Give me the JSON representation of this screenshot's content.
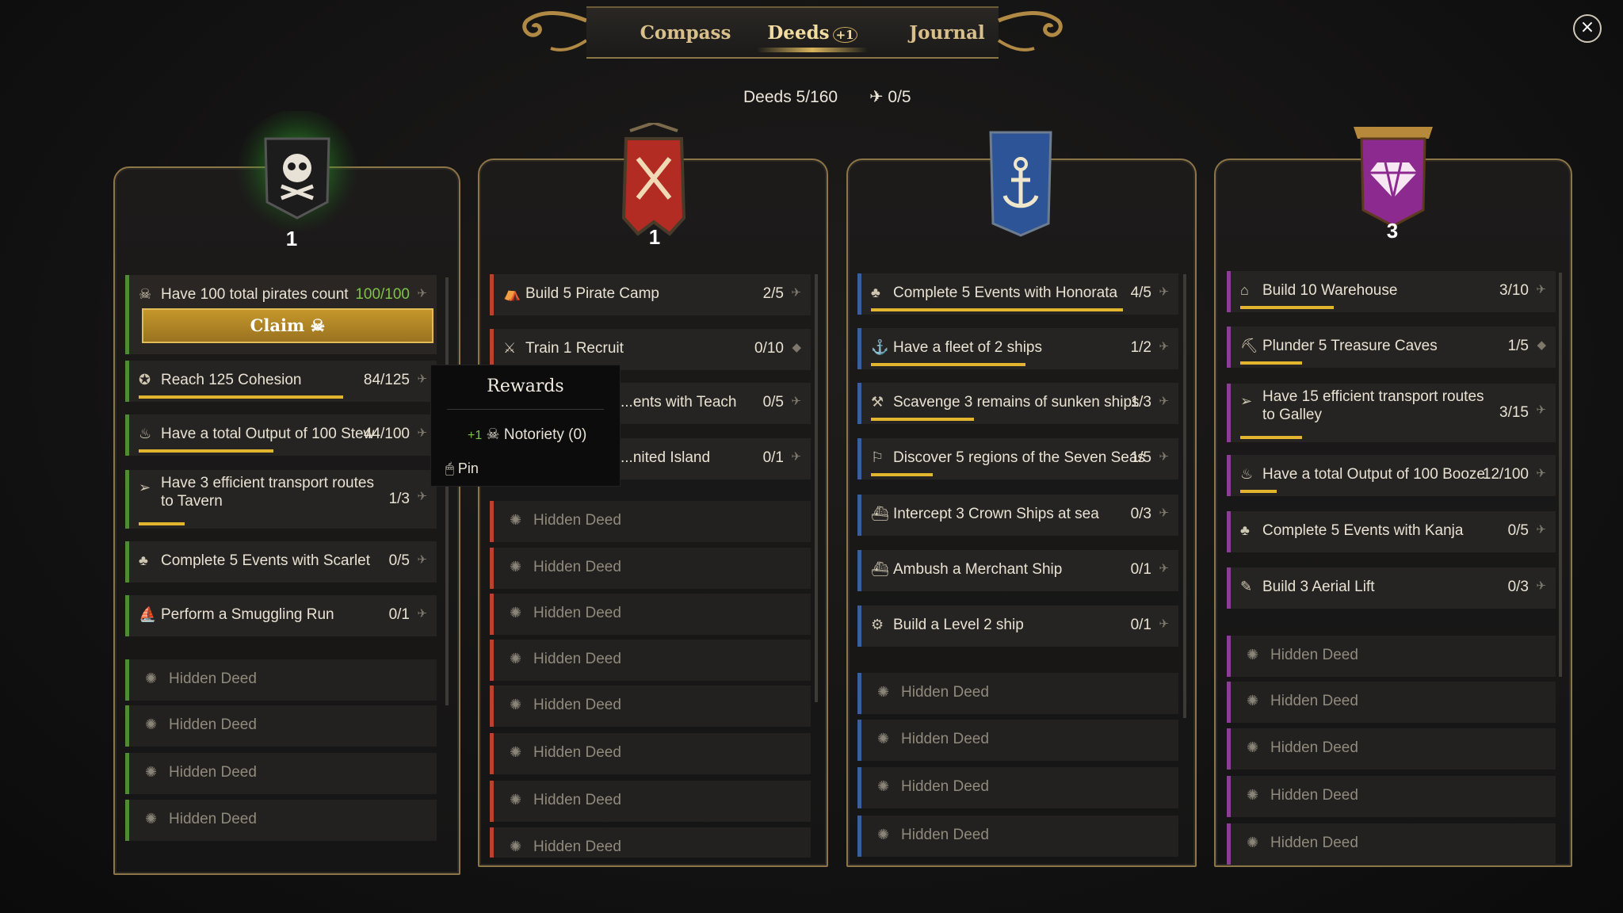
{
  "tabs": {
    "compass": "Compass",
    "deeds": "Deeds",
    "deeds_badge": "+1",
    "journal": "Journal"
  },
  "close_icon": "×",
  "summary": {
    "deeds_label": "Deeds",
    "deeds_count": "5/160",
    "pin_icon": "✈",
    "pinned": "0/5"
  },
  "colors": {
    "gold": "#e3b52f",
    "green": "#4e8b35",
    "red": "#b7432f",
    "blue": "#3b5f9c",
    "purple": "#8a3f94"
  },
  "columns": [
    {
      "banner": "skull-flag",
      "level": "1",
      "deeds": [
        {
          "name": "Have 100 total pirates count",
          "progress": "100/100",
          "claim": "Claim",
          "fill": 1.0
        },
        {
          "name": "Reach 125 Cohesion",
          "progress": "84/125",
          "fill": 0.67
        },
        {
          "name": "Have a total Output of 100 Stew",
          "progress": "44/100",
          "fill": 0.44
        },
        {
          "name": "Have 3 efficient transport routes to Tavern",
          "progress": "1/3",
          "fill": 0.33
        },
        {
          "name": "Complete 5 Events with Scarlet",
          "progress": "0/5",
          "fill": 0
        },
        {
          "name": "Perform a Smuggling Run",
          "progress": "0/1",
          "fill": 0
        }
      ],
      "hidden": [
        "Hidden Deed",
        "Hidden Deed",
        "Hidden Deed",
        "Hidden Deed"
      ]
    },
    {
      "banner": "crossed-swords-flag",
      "level": "1",
      "deeds": [
        {
          "name": "Build 5 Pirate Camp",
          "progress": "2/5",
          "fill": 0.4
        },
        {
          "name": "Train 1 Recruit",
          "progress": "0/10",
          "fill": 0
        },
        {
          "name": "...ents with Teach",
          "progress": "0/5",
          "fill": 0
        },
        {
          "name": "...nited Island",
          "progress": "0/1",
          "fill": 0
        }
      ],
      "hidden": [
        "Hidden Deed",
        "Hidden Deed",
        "Hidden Deed",
        "Hidden Deed",
        "Hidden Deed",
        "Hidden Deed",
        "Hidden Deed",
        "Hidden Deed"
      ]
    },
    {
      "banner": "anchor-flag",
      "level": "",
      "deeds": [
        {
          "name": "Complete 5 Events with Honorata",
          "progress": "4/5",
          "fill": 0.8
        },
        {
          "name": "Have a fleet of 2 ships",
          "progress": "1/2",
          "fill": 0.5
        },
        {
          "name": "Scavenge 3 remains of sunken ships",
          "progress": "1/3",
          "fill": 0.33
        },
        {
          "name": "Discover 5 regions of the Seven Seas",
          "progress": "1/5",
          "fill": 0.2
        },
        {
          "name": "Intercept 3 Crown Ships at sea",
          "progress": "0/3",
          "fill": 0
        },
        {
          "name": "Ambush a Merchant Ship",
          "progress": "0/1",
          "fill": 0
        },
        {
          "name": "Build a Level 2 ship",
          "progress": "0/1",
          "fill": 0
        }
      ],
      "hidden": [
        "Hidden Deed",
        "Hidden Deed",
        "Hidden Deed",
        "Hidden Deed"
      ]
    },
    {
      "banner": "gem-flag",
      "level": "3",
      "deeds": [
        {
          "name": "Build 10 Warehouse",
          "progress": "3/10",
          "fill": 0.3
        },
        {
          "name": "Plunder 5 Treasure Caves",
          "progress": "1/5",
          "fill": 0.2
        },
        {
          "name": "Have 15 efficient transport routes to Galley",
          "progress": "3/15",
          "fill": 0.2
        },
        {
          "name": "Have a total Output of 100 Booze",
          "progress": "12/100",
          "fill": 0.12
        },
        {
          "name": "Complete 5 Events with Kanja",
          "progress": "0/5",
          "fill": 0
        },
        {
          "name": "Build 3 Aerial Lift",
          "progress": "0/3",
          "fill": 0
        }
      ],
      "hidden": [
        "Hidden Deed",
        "Hidden Deed",
        "Hidden Deed",
        "Hidden Deed",
        "Hidden Deed"
      ]
    }
  ],
  "tooltip": {
    "title": "Rewards",
    "reward_plus": "+1",
    "reward_text": "Notoriety (0)",
    "pin_label": "Pin"
  }
}
